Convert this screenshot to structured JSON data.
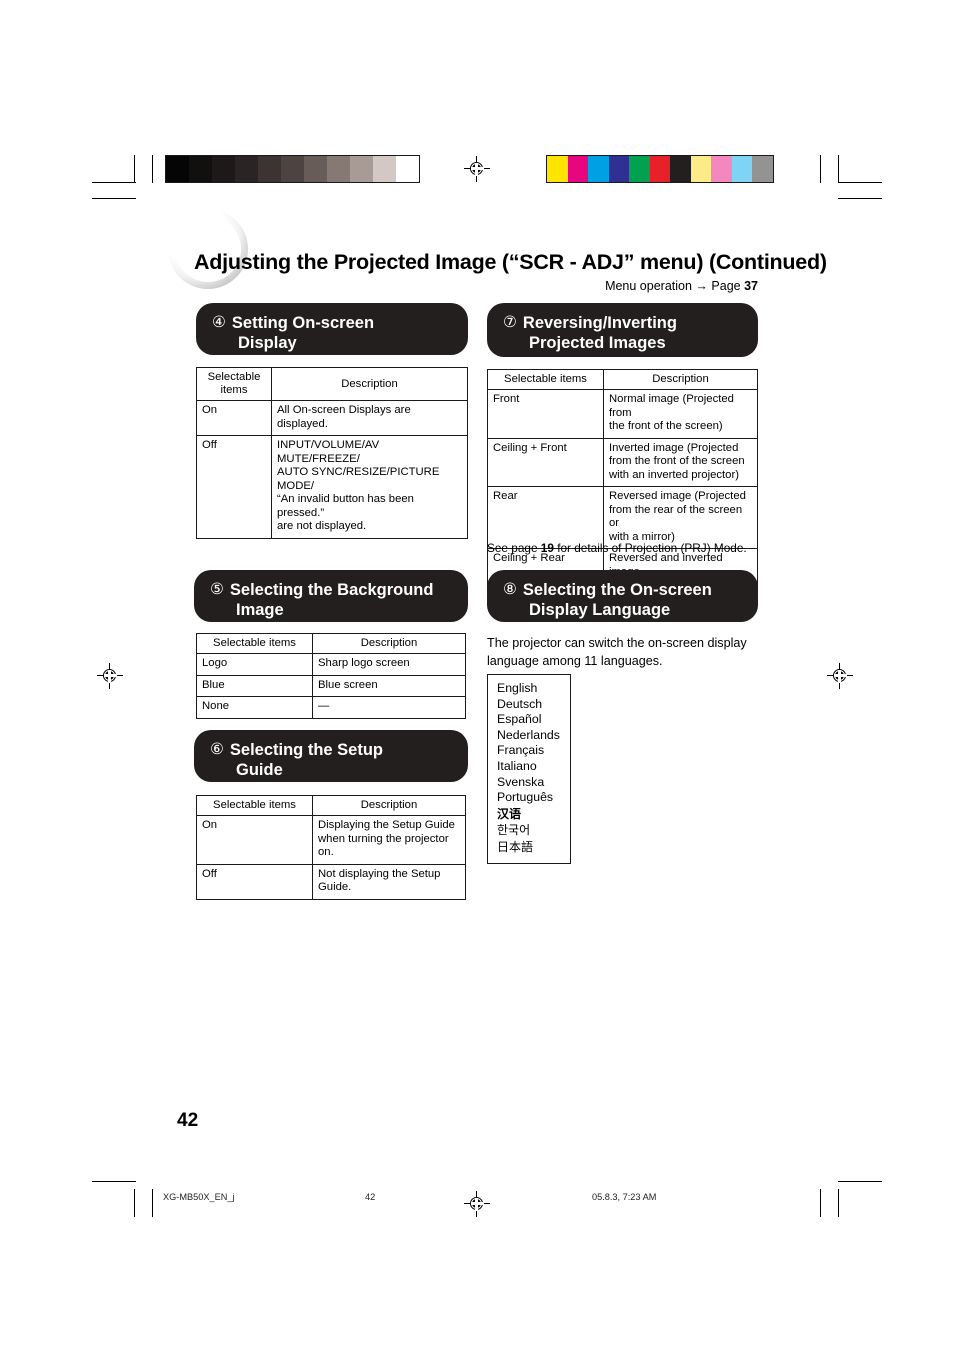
{
  "document": {
    "title": "Adjusting the Projected Image (“SCR - ADJ” menu) (Continued)",
    "menu_operation": "Menu operation",
    "menu_operation_arrow": "→",
    "menu_operation_page_label": "Page",
    "menu_operation_page": "37",
    "page_number": "42"
  },
  "sections": {
    "s4": {
      "number": "④",
      "line1": "Setting On-screen",
      "line2": "Display",
      "table": {
        "headers": [
          "Selectable items",
          "Description"
        ],
        "header_col1_line1": "Selectable",
        "header_col1_line2": "items",
        "rows": [
          {
            "item": "On",
            "description": "All On-screen Displays are displayed."
          },
          {
            "item": "Off",
            "description": "INPUT/VOLUME/AV MUTE/FREEZE/\nAUTO SYNC/RESIZE/PICTURE MODE/\n“An invalid button has been pressed.”\nare not displayed."
          }
        ]
      }
    },
    "s5": {
      "number": "⑤",
      "line1": "Selecting the Background",
      "line2": "Image",
      "table": {
        "headers": [
          "Selectable items",
          "Description"
        ],
        "rows": [
          {
            "item": "Logo",
            "description": "Sharp logo screen"
          },
          {
            "item": "Blue",
            "description": "Blue screen"
          },
          {
            "item": "None",
            "description": "—"
          }
        ]
      }
    },
    "s6": {
      "number": "⑥",
      "line1": "Selecting the Setup",
      "line2": "Guide",
      "table": {
        "headers": [
          "Selectable items",
          "Description"
        ],
        "rows": [
          {
            "item": "On",
            "description": "Displaying the Setup Guide\nwhen turning the projector on."
          },
          {
            "item": "Off",
            "description": "Not displaying the Setup\nGuide."
          }
        ]
      }
    },
    "s7": {
      "number": "⑦",
      "line1": "Reversing/Inverting",
      "line2": "Projected Images",
      "table": {
        "headers": [
          "Selectable items",
          "Description"
        ],
        "rows": [
          {
            "item": "Front",
            "description": "Normal image (Projected from\nthe front of the screen)"
          },
          {
            "item": "Ceiling + Front",
            "description": "Inverted image (Projected\nfrom the front of the screen\nwith an inverted projector)"
          },
          {
            "item": "Rear",
            "description": "Reversed image (Projected\nfrom the rear of the screen or\nwith a mirror)"
          },
          {
            "item": "Ceiling + Rear",
            "description": "Reversed and inverted image\n(Projected with a mirror)"
          }
        ]
      },
      "note_before": "See page ",
      "note_page": "19",
      "note_after": " for details of Projection (PRJ) Mode."
    },
    "s8": {
      "number": "⑧",
      "line1": "Selecting the On-screen",
      "line2": "Display Language",
      "paragraph": "The projector can switch the on-screen display language among 11 languages.",
      "languages": [
        "English",
        "Deutsch",
        "Español",
        "Nederlands",
        "Français",
        "Italiano",
        "Svenska",
        "Português",
        "汉语",
        "한국어",
        "日本語"
      ]
    }
  },
  "footer": {
    "filename": "XG-MB50X_EN_j",
    "page": "42",
    "timestamp": "05.8.3, 7:23 AM"
  },
  "print_marks": {
    "grayscale_swatches": [
      "#050505",
      "#120f0f",
      "#1d1919",
      "#2a2524",
      "#3b3432",
      "#4d4442",
      "#675c58",
      "#867974",
      "#a89b95",
      "#d3c8c3",
      "#ffffff"
    ],
    "color_swatches": [
      "#ffe400",
      "#e8067f",
      "#00a0e4",
      "#2e3192",
      "#00a250",
      "#e8202a",
      "#231f1f",
      "#fdeb8a",
      "#f487bd",
      "#7fd3f4",
      "#939393"
    ]
  }
}
